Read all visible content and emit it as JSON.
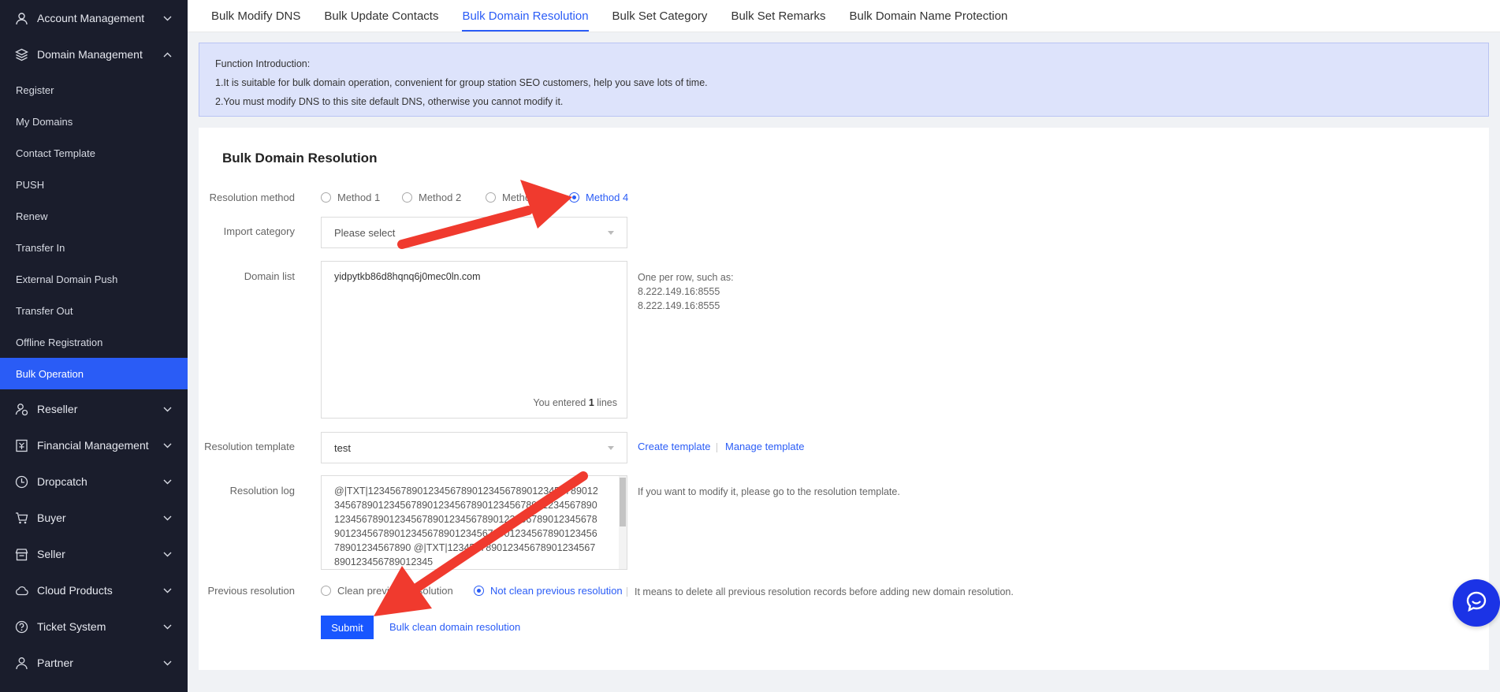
{
  "sidebar": {
    "groups_top": [
      {
        "label": "Account Management",
        "icon": "user-icon",
        "expanded": false
      },
      {
        "label": "Domain Management",
        "icon": "layers-icon",
        "expanded": true
      }
    ],
    "domain_items": [
      {
        "label": "Register"
      },
      {
        "label": "My Domains"
      },
      {
        "label": "Contact Template"
      },
      {
        "label": "PUSH"
      },
      {
        "label": "Renew"
      },
      {
        "label": "Transfer In"
      },
      {
        "label": "External Domain Push"
      },
      {
        "label": "Transfer Out"
      },
      {
        "label": "Offline Registration"
      },
      {
        "label": "Bulk Operation",
        "active": true
      }
    ],
    "groups_bottom": [
      {
        "label": "Reseller",
        "icon": "reseller-icon"
      },
      {
        "label": "Financial Management",
        "icon": "finance-icon"
      },
      {
        "label": "Dropcatch",
        "icon": "clock-icon"
      },
      {
        "label": "Buyer",
        "icon": "cart-icon"
      },
      {
        "label": "Seller",
        "icon": "store-icon"
      },
      {
        "label": "Cloud Products",
        "icon": "cloud-icon"
      },
      {
        "label": "Ticket System",
        "icon": "question-icon"
      },
      {
        "label": "Partner",
        "icon": "partner-icon"
      }
    ]
  },
  "tabs": [
    {
      "label": "Bulk Modify DNS"
    },
    {
      "label": "Bulk Update Contacts"
    },
    {
      "label": "Bulk Domain Resolution",
      "active": true
    },
    {
      "label": "Bulk Set Category"
    },
    {
      "label": "Bulk Set Remarks"
    },
    {
      "label": "Bulk Domain Name Protection"
    }
  ],
  "intro": {
    "title": "Function Introduction:",
    "line1": "1.It is suitable for bulk domain operation, convenient for group station SEO customers, help you save lots of time.",
    "line2": "2.You must modify DNS to this site default DNS, otherwise you cannot modify it."
  },
  "form": {
    "title": "Bulk Domain Resolution",
    "method_label": "Resolution method",
    "methods": [
      "Method 1",
      "Method 2",
      "Method 3",
      "Method 4"
    ],
    "selected_method": "Method 4",
    "import_label": "Import category",
    "import_placeholder": "Please select",
    "domain_list_label": "Domain list",
    "domain_list_value": "yidpytkb86d8hqnq6j0mec0ln.com",
    "line_count_prefix": "You entered",
    "line_count": "1",
    "line_count_suffix": "lines",
    "domain_hint_1": "One per row, such as:",
    "domain_hint_2": "8.222.149.16:8555",
    "domain_hint_3": "8.222.149.16:8555",
    "template_label": "Resolution template",
    "template_value": "test",
    "create_template": "Create template",
    "manage_template": "Manage template",
    "log_label": "Resolution log",
    "log_value": "@|TXT|12345678901234567890123456789012345678901234567890123456789012345678901234567890123456789012345678901234567890123456789012345678901234567890123456789012345678901234567890123456789012345678901234567890\n@|TXT|123456789012345678901234567890123456789012345",
    "log_hint": "If you want to modify it, please go to the resolution template.",
    "previous_label": "Previous resolution",
    "clean_previous": "Clean previous resolution",
    "not_clean_previous": "Not clean previous resolution",
    "previous_hint": "It means to delete all previous resolution records before adding new domain resolution.",
    "submit": "Submit",
    "bulk_clean": "Bulk clean domain resolution"
  },
  "colors": {
    "accent": "#2a5cf6",
    "sidebar_bg": "#1a1d2c",
    "arrow": "#f03a2e"
  }
}
